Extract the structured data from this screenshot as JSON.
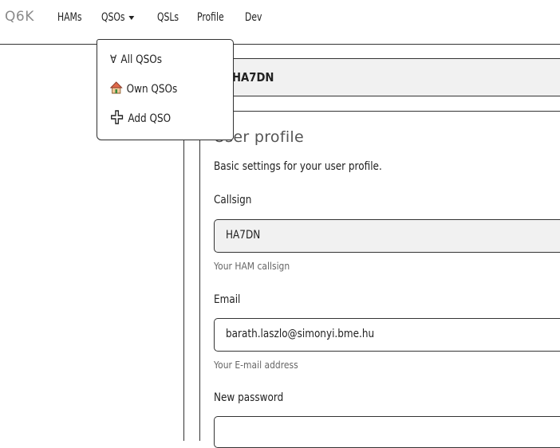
{
  "navbar": {
    "brand": "Q6K",
    "items": [
      {
        "label": "HAMs"
      },
      {
        "label": "QSOs"
      },
      {
        "label": "QSLs"
      },
      {
        "label": "Profile"
      },
      {
        "label": "Dev"
      }
    ]
  },
  "qsos_dropdown": {
    "items": [
      {
        "label": "All QSOs",
        "icon": "for-all-icon",
        "glyph": "∀"
      },
      {
        "label": "Own QSOs",
        "icon": "house-icon",
        "glyph": "🏠"
      },
      {
        "label": "Add QSO",
        "icon": "plus-icon",
        "glyph": "✚"
      }
    ]
  },
  "header_callsign": "HA7DN",
  "profile": {
    "title": "User profile",
    "description": "Basic settings for your user profile.",
    "callsign": {
      "label": "Callsign",
      "value": "HA7DN",
      "help": "Your HAM callsign"
    },
    "email": {
      "label": "Email",
      "value": "barath.laszlo@simonyi.bme.hu",
      "help": "Your E-mail address"
    },
    "new_password": {
      "label": "New password",
      "value": ""
    }
  },
  "colors": {
    "line": "#333333",
    "readonly_bg": "#f1f1f1",
    "brand": "#8a8a8a",
    "help_text": "#666666"
  }
}
